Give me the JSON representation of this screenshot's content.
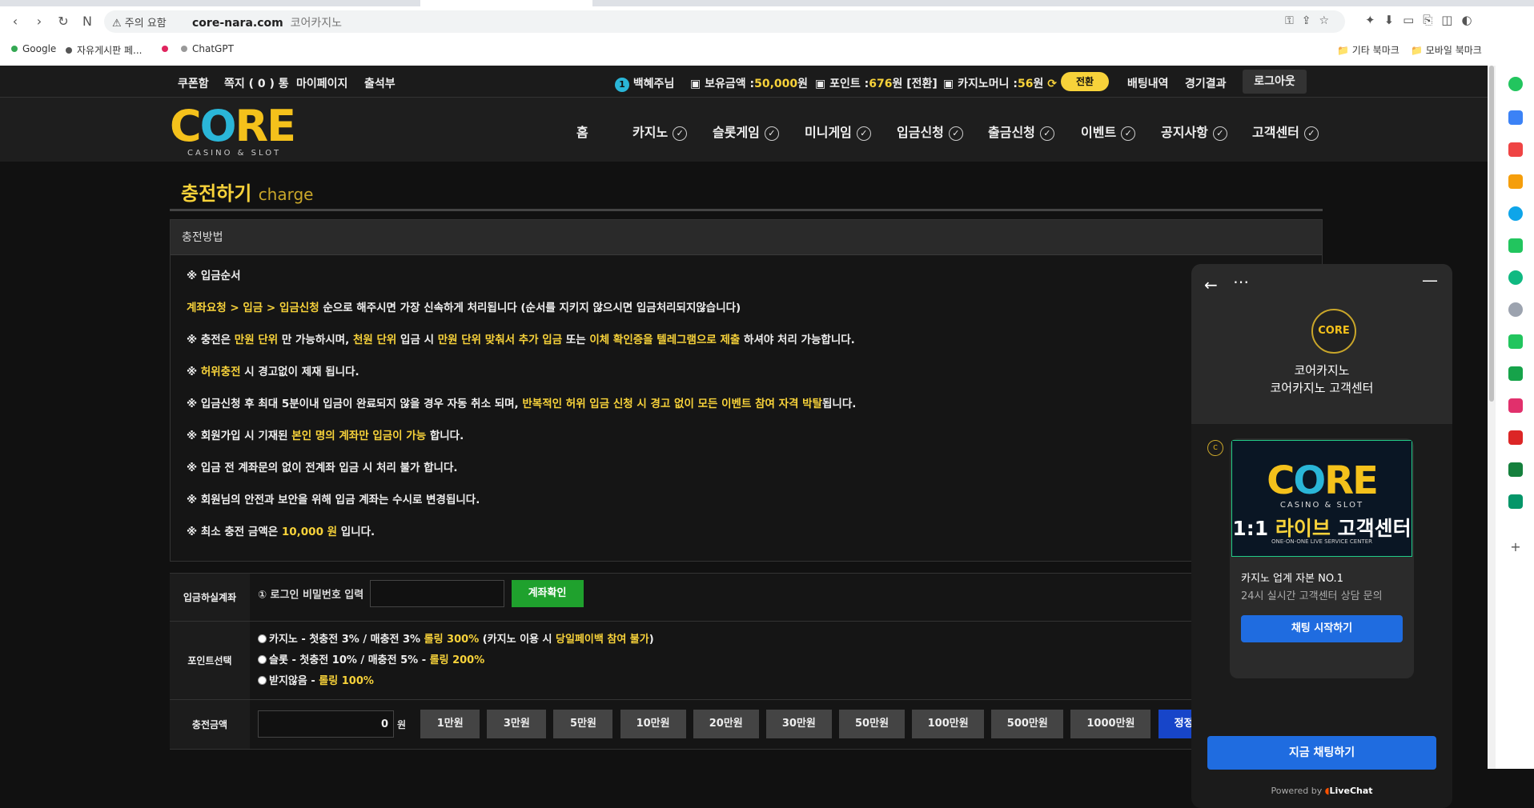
{
  "browser": {
    "warning": "주의 요함",
    "url": "core-nara.com",
    "page_title": "코어카지노",
    "bookmarks": [
      "Google",
      "자유게시판 페...",
      "",
      "ChatGPT"
    ],
    "bookmark_folders": [
      "기타 북마크",
      "모바일 북마크"
    ]
  },
  "topbar": {
    "links": [
      "쿠폰함",
      "쪽지 ( 0 ) 통",
      "마이페이지",
      "출석부"
    ],
    "user_level": "1",
    "user_name": "백혜주님",
    "balance_label": "보유금액 :",
    "balance_value": "50,000",
    "balance_unit": "원",
    "point_label": "포인트 :",
    "point_value": "676",
    "point_unit": "원 [전환]",
    "casino_money_label": "카지노머니 :",
    "casino_money_value": "56",
    "casino_money_unit": "원",
    "swap_label": "전환",
    "bet_history": "배팅내역",
    "game_results": "경기결과",
    "logout": "로그아웃"
  },
  "logo": {
    "sub": "CASINO & SLOT"
  },
  "nav": [
    "홈",
    "카지노",
    "슬롯게임",
    "미니게임",
    "입금신청",
    "출금신청",
    "이벤트",
    "공지사항",
    "고객센터"
  ],
  "page": {
    "title": "충전하기",
    "title_en": "charge",
    "method_title": "충전방법"
  },
  "notice": {
    "l1": "※ 입금순서",
    "l2a": "계좌요청 > 입금 > 입금신청",
    "l2b": " 순으로 해주시면 가장 신속하게 처리됩니다 (순서를 지키지 않으시면 입금처리되지않습니다)",
    "l3a": "※ 충전은 ",
    "l3b": "만원 단위",
    "l3c": " 만 가능하시며, ",
    "l3d": "천원 단위",
    "l3e": " 입금 시 ",
    "l3f": "만원 단위 맞춰서 추가 입금",
    "l3g": " 또는 ",
    "l3h": "이체 확인증을 텔레그램으로 제출",
    "l3i": " 하셔야 처리 가능합니다.",
    "l4a": "※ ",
    "l4b": "허위충전",
    "l4c": " 시 경고없이 제재 됩니다.",
    "l5a": "※ 입금신청 후 최대 5분이내 입금이 완료되지 않을 경우 자동 취소 되며, ",
    "l5b": "반복적인 허위 입금 신청 시 경고 없이 모든 이벤트 참여 자격 박탈",
    "l5c": "됩니다.",
    "l6a": "※ 회원가입 시 기재된 ",
    "l6b": "본인 명의 계좌만 입금이 가능",
    "l6c": " 합니다.",
    "l7": "※ 입금 전 계좌문의 없이 전계좌 입금 시 처리 불가 합니다.",
    "l8": "※ 회원님의 안전과 보안을 위해 입금 계좌는 수시로 변경됩니다.",
    "l9a": "※ 최소 충전 금액은 ",
    "l9b": "10,000 원",
    "l9c": " 입니다."
  },
  "form": {
    "account_label": "입금하실계좌",
    "pw_label": "① 로그인 비밀번호 입력",
    "acct_btn": "계좌확인",
    "point_label": "포인트선택",
    "opt1a": "카지노 - 첫충전 3% / 매충전 3% ",
    "opt1b": "롤링 300%",
    "opt1c": " (카지노 이용 시 ",
    "opt1d": "당일페이백 참여 불가",
    "opt1e": ")",
    "opt2a": "슬롯 - 첫충전 10% / 매충전 5% - ",
    "opt2b": "롤링 200%",
    "opt3a": "받지않음 - ",
    "opt3b": "롤링 100%",
    "amount_label": "충전금액",
    "amount_value": "0",
    "won": "원",
    "amounts": [
      "1만원",
      "3만원",
      "5만원",
      "10만원",
      "20만원",
      "30만원",
      "50만원",
      "100만원",
      "500만원",
      "1000만원"
    ],
    "reset": "정정"
  },
  "chat": {
    "name": "코어카지노",
    "sub": "코어카지노 고객센터",
    "card_casino": "CASINO & SLOT",
    "card_live_a": "1:1 ",
    "card_live_b": "라이브",
    "card_live_c": " 고객센터",
    "card_tag": "ONE-ON-ONE LIVE SERVICE CENTER",
    "card_t1": "카지노 업계 자본 NO.1",
    "card_t2": "24시 실시간 고객센터 상담 문의",
    "card_btn": "채팅 시작하기",
    "main_btn": "지금 채팅하기",
    "powered": "Powered by",
    "brand": "LiveChat"
  },
  "colors": {
    "accent": "#f7d23a",
    "green": "#1fa12d",
    "blue": "#1f6ce0"
  }
}
